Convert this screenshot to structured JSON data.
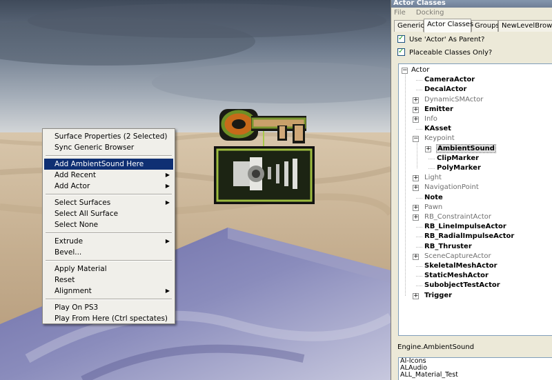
{
  "panel": {
    "title": "Actor Classes",
    "menu": [
      "File",
      "Docking"
    ],
    "tabs": [
      "Generic",
      "Actor Classes",
      "Groups",
      "NewLevelBrowser"
    ],
    "options": [
      {
        "label": "Use 'Actor' As Parent?",
        "checked": true
      },
      {
        "label": "Placeable Classes Only?",
        "checked": true
      }
    ],
    "tree": [
      {
        "label": "Actor",
        "style": "normal",
        "expander": "⊟"
      },
      {
        "label": "CameraActor",
        "style": "bold",
        "expander": ""
      },
      {
        "label": "DecalActor",
        "style": "bold",
        "expander": ""
      },
      {
        "label": "DynamicSMActor",
        "style": "gray",
        "expander": "⊞"
      },
      {
        "label": "Emitter",
        "style": "bold",
        "expander": "⊞"
      },
      {
        "label": "Info",
        "style": "gray",
        "expander": "⊞"
      },
      {
        "label": "KAsset",
        "style": "bold",
        "expander": ""
      },
      {
        "label": "Keypoint",
        "style": "gray",
        "expander": "⊟"
      },
      {
        "label": "AmbientSound",
        "style": "bold",
        "expander": "⊞"
      },
      {
        "label": "ClipMarker",
        "style": "bold",
        "expander": ""
      },
      {
        "label": "PolyMarker",
        "style": "bold",
        "expander": ""
      },
      {
        "label": "Light",
        "style": "gray",
        "expander": "⊞"
      },
      {
        "label": "NavigationPoint",
        "style": "gray",
        "expander": "⊞"
      },
      {
        "label": "Note",
        "style": "bold",
        "expander": ""
      },
      {
        "label": "Pawn",
        "style": "gray",
        "expander": "⊞"
      },
      {
        "label": "RB_ConstraintActor",
        "style": "gray",
        "expander": "⊞"
      },
      {
        "label": "RB_LineImpulseActor",
        "style": "bold",
        "expander": ""
      },
      {
        "label": "RB_RadialImpulseActor",
        "style": "bold",
        "expander": ""
      },
      {
        "label": "RB_Thruster",
        "style": "bold",
        "expander": ""
      },
      {
        "label": "SceneCaptureActor",
        "style": "gray",
        "expander": "⊞"
      },
      {
        "label": "SkeletalMeshActor",
        "style": "bold",
        "expander": ""
      },
      {
        "label": "StaticMeshActor",
        "style": "bold",
        "expander": ""
      },
      {
        "label": "SubobjectTestActor",
        "style": "bold",
        "expander": ""
      },
      {
        "label": "Trigger",
        "style": "bold",
        "expander": "⊞"
      }
    ],
    "selected_class": "AmbientSound",
    "status_path": "Engine.AmbientSound",
    "packages": [
      "AI-Icons",
      "ALAudio",
      "ALL_Material_Test"
    ]
  },
  "context_menu": {
    "groups": [
      [
        {
          "label": "Surface Properties (2 Selected)",
          "submenu": false,
          "highlight": false
        },
        {
          "label": "Sync Generic Browser",
          "submenu": false,
          "highlight": false
        }
      ],
      [
        {
          "label": "Add AmbientSound Here",
          "submenu": false,
          "highlight": true
        },
        {
          "label": "Add Recent",
          "submenu": true,
          "highlight": false
        },
        {
          "label": "Add Actor",
          "submenu": true,
          "highlight": false
        }
      ],
      [
        {
          "label": "Select Surfaces",
          "submenu": true,
          "highlight": false
        },
        {
          "label": "Select All Surface",
          "submenu": false,
          "highlight": false
        },
        {
          "label": "Select None",
          "submenu": false,
          "highlight": false
        }
      ],
      [
        {
          "label": "Extrude",
          "submenu": true,
          "highlight": false
        },
        {
          "label": "Bevel...",
          "submenu": false,
          "highlight": false
        }
      ],
      [
        {
          "label": "Apply Material",
          "submenu": false,
          "highlight": false
        },
        {
          "label": "Reset",
          "submenu": false,
          "highlight": false
        },
        {
          "label": "Alignment",
          "submenu": true,
          "highlight": false
        }
      ],
      [
        {
          "label": "Play On PS3",
          "submenu": false,
          "highlight": false
        },
        {
          "label": "Play From Here (Ctrl spectates)",
          "submenu": false,
          "highlight": false
        }
      ]
    ]
  },
  "viewport": {
    "icon": "ambient-sound-key-icon",
    "colors": {
      "highlight": "#0f2f73",
      "sky": "#6f7f92",
      "floor": "#c9b497",
      "block": "#5a5a96"
    }
  }
}
